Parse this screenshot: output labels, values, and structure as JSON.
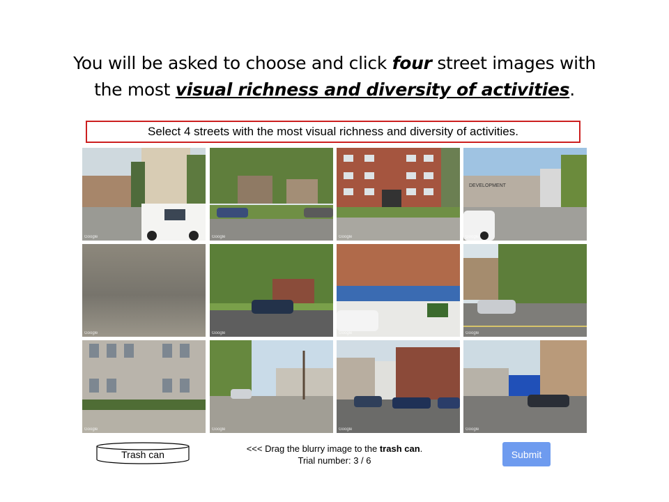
{
  "instruction": {
    "line1_pre": "You will be asked to choose and click ",
    "line1_em": "four",
    "line1_post": " street images with",
    "line2_pre": "the most ",
    "line2_em": "visual richness and diversity of activities",
    "line2_post": "."
  },
  "prompt": "Select 4 streets with the most visual richness and diversity of activities.",
  "tiles": [
    {
      "id": "r1c1",
      "watermark": "Google"
    },
    {
      "id": "r1c2",
      "watermark": "Google"
    },
    {
      "id": "r1c3",
      "watermark": "Google"
    },
    {
      "id": "r1c4",
      "watermark": "Google",
      "sign": "DEVELOPMENT"
    },
    {
      "id": "r2c1",
      "watermark": "Google"
    },
    {
      "id": "r2c2",
      "watermark": "Google"
    },
    {
      "id": "r2c3",
      "watermark": "Google"
    },
    {
      "id": "r2c4",
      "watermark": "Google"
    },
    {
      "id": "r3c1",
      "watermark": "Google"
    },
    {
      "id": "r3c2",
      "watermark": "Google"
    },
    {
      "id": "r3c3",
      "watermark": "Google"
    },
    {
      "id": "r3c4",
      "watermark": "Google"
    }
  ],
  "trash": {
    "label": "Trash can"
  },
  "drag_message": {
    "pre": "<<< Drag the blurry image to the ",
    "bold": "trash can",
    "post": "."
  },
  "trial": "Trial number: 3 / 6",
  "submit_label": "Submit",
  "colors": {
    "prompt_border": "#cc1f1f",
    "submit_bg": "#6e9bef"
  }
}
